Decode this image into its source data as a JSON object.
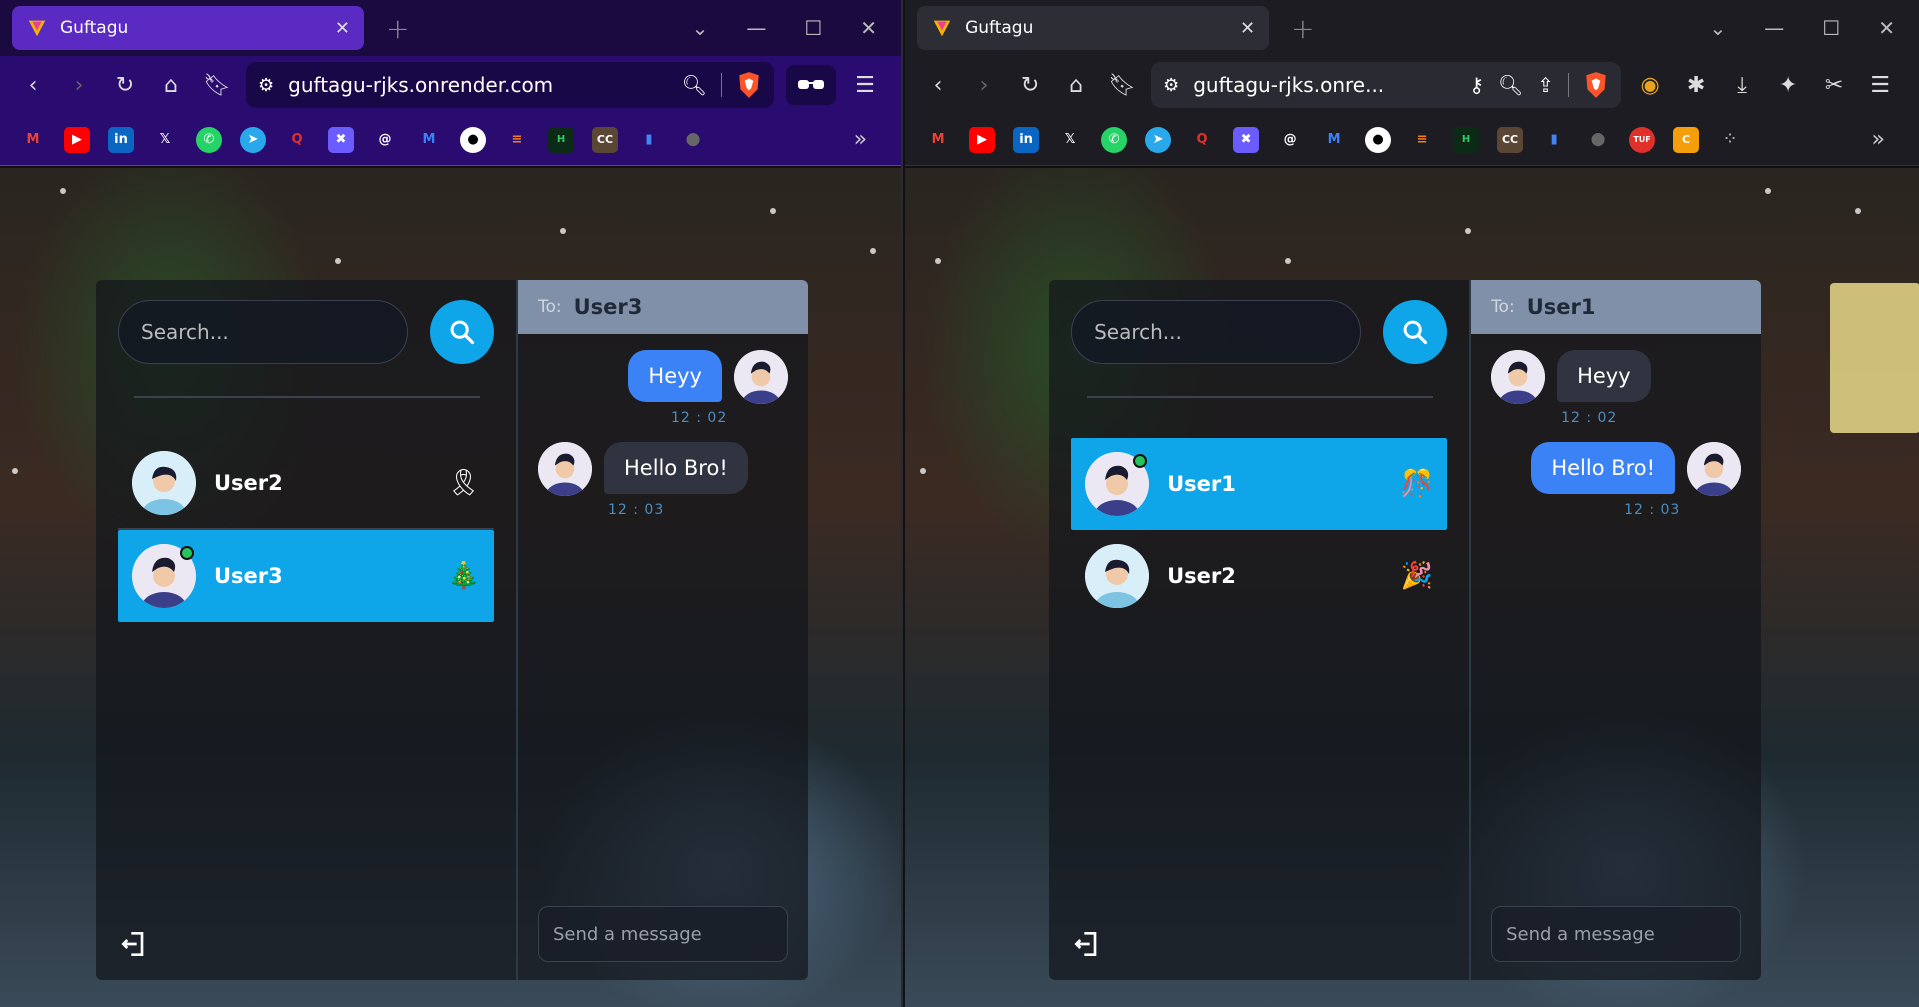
{
  "left_window": {
    "tab_title": "Guftagu",
    "url": "guftagu-rjks.onrender.com",
    "search_placeholder": "Search...",
    "contacts": [
      {
        "name": "User2",
        "emoji": "🎗",
        "active": false,
        "online": false
      },
      {
        "name": "User3",
        "emoji": "🎄",
        "active": true,
        "online": true
      }
    ],
    "chat": {
      "to_label": "To:",
      "to_name": "User3",
      "messages": [
        {
          "text": "Heyy",
          "time": "12 : 02",
          "from_me": true
        },
        {
          "text": "Hello Bro!",
          "time": "12 : 03",
          "from_me": false
        }
      ],
      "composer_placeholder": "Send a message"
    }
  },
  "right_window": {
    "tab_title": "Guftagu",
    "url": "guftagu-rjks.onre...",
    "search_placeholder": "Search...",
    "contacts": [
      {
        "name": "User1",
        "emoji": "🎊",
        "active": true,
        "online": true
      },
      {
        "name": "User2",
        "emoji": "🎉",
        "active": false,
        "online": false
      }
    ],
    "chat": {
      "to_label": "To:",
      "to_name": "User1",
      "messages": [
        {
          "text": "Heyy",
          "time": "12 : 02",
          "from_me": false
        },
        {
          "text": "Hello Bro!",
          "time": "12 : 03",
          "from_me": true
        }
      ],
      "composer_placeholder": "Send a message"
    }
  },
  "colors": {
    "accent": "#0ea5e9",
    "my_bubble": "#3b82f6",
    "their_bubble": "#2f3440",
    "online": "#22c55e",
    "left_browser_theme": "#2a0b70"
  },
  "icons": {
    "search": "search-icon",
    "send": "send-icon",
    "logout": "logout-icon"
  }
}
